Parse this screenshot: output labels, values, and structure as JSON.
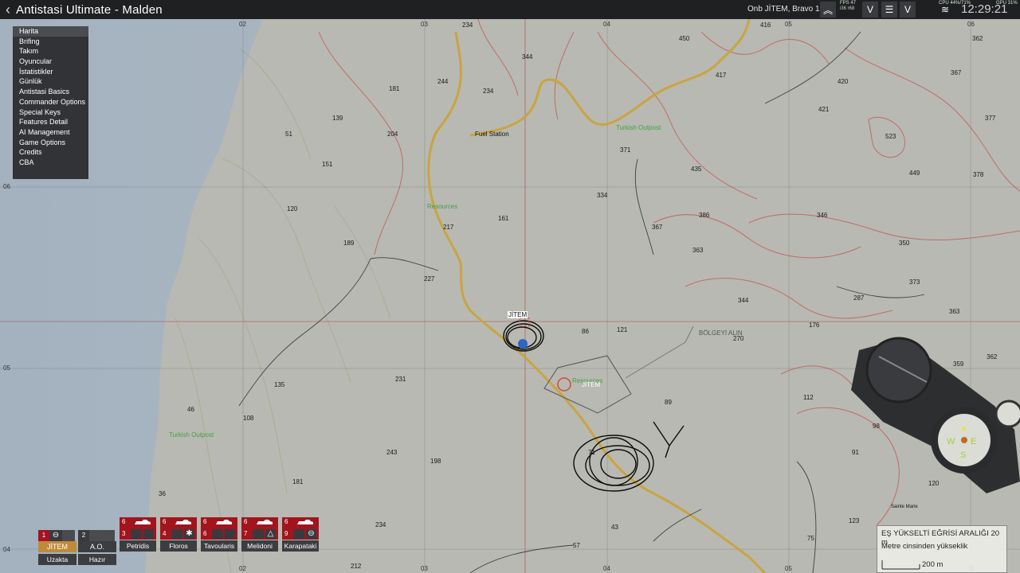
{
  "window": {
    "title": "Antistasi Ultimate - Malden",
    "back_icon": "chevron-left-icon"
  },
  "hud": {
    "player": "Onb JİTEM, Bravo 1-6 1",
    "fps": "FPS 47",
    "perf": "i36 r68",
    "cpu": "CPU 44%/71%",
    "gpu": "GPU 31%",
    "clock": "12:29:21"
  },
  "menu": {
    "items": [
      "Harita",
      "Brifing",
      "Takım",
      "Oyuncular",
      "İstatistikler",
      "Günlük",
      "Antistasi Basics",
      "Commander Options",
      "Special Keys",
      "Features Detail",
      "AI Management",
      "Game Options",
      "Credits",
      "CBA"
    ]
  },
  "map": {
    "grid_x": [
      "02",
      "03",
      "04",
      "05",
      "06"
    ],
    "grid_y": [
      "06",
      "05",
      "04"
    ],
    "locations": [
      "Fuel Station",
      "Turkish Outpost",
      "Turkish Outpost",
      "Resources",
      "Resources",
      "JİTEM",
      "JİTEM",
      "BÖLGEYİ ALIN",
      "Sainte Marie"
    ],
    "elevations": [
      "234",
      "344",
      "244",
      "234",
      "416",
      "450",
      "417",
      "362",
      "367",
      "420",
      "421",
      "377",
      "181",
      "139",
      "204",
      "51",
      "151",
      "371",
      "435",
      "523",
      "449",
      "378",
      "120",
      "334",
      "161",
      "217",
      "386",
      "367",
      "346",
      "189",
      "363",
      "350",
      "227",
      "373",
      "344",
      "287",
      "363",
      "86",
      "121",
      "270",
      "176",
      "359",
      "362",
      "231",
      "135",
      "46",
      "108",
      "89",
      "112",
      "98",
      "243",
      "198",
      "71",
      "91",
      "181",
      "36",
      "120",
      "234",
      "43",
      "123",
      "57",
      "75",
      "212",
      "346",
      "338",
      "202"
    ]
  },
  "groups": {
    "mine": {
      "number": "1",
      "name": "JİTEM",
      "status": "Uzakta"
    },
    "ao": {
      "number": "2",
      "name": "A.O.",
      "status": "Hazır"
    },
    "others": [
      {
        "count": "6",
        "number": "3",
        "name": "Petridis",
        "icon": ""
      },
      {
        "count": "6",
        "number": "4",
        "name": "Floros",
        "icon": "✱"
      },
      {
        "count": "6",
        "number": "6",
        "name": "Tavoularis",
        "icon": ""
      },
      {
        "count": "6",
        "number": "7",
        "name": "Melidoni",
        "icon": "△"
      },
      {
        "count": "6",
        "number": "9",
        "name": "Karapataki",
        "icon": "⊖"
      }
    ]
  },
  "legend": {
    "line1": "EŞ YÜKSELTİ EĞRİSİ ARALIĞI 20 m",
    "line2": "Metre cinsinden yükseklik",
    "scale": "200 m"
  },
  "colors": {
    "sea": "#a9b6c3",
    "land": "#b7b8b1",
    "contour": "#c44a4a",
    "road": "#c9a441",
    "grid": "#a3141d",
    "group": "#a3141d"
  }
}
